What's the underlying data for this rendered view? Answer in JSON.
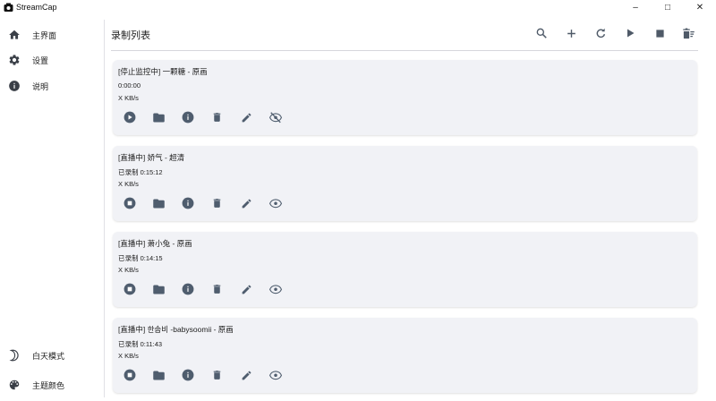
{
  "window": {
    "title": "StreamCap",
    "controls": {
      "minimize": "–",
      "maximize": "□",
      "close": "✕"
    }
  },
  "sidebar": {
    "items": [
      {
        "label": "主界面",
        "icon": "home-icon"
      },
      {
        "label": "设置",
        "icon": "gear-icon"
      },
      {
        "label": "说明",
        "icon": "info-icon"
      }
    ],
    "bottom": [
      {
        "label": "白天模式",
        "icon": "moon-icon"
      },
      {
        "label": "主题颜色",
        "icon": "palette-icon"
      }
    ]
  },
  "header": {
    "title": "录制列表",
    "tools": [
      "search-icon",
      "add-icon",
      "refresh-icon",
      "play-all-icon",
      "stop-all-icon",
      "delete-all-icon"
    ]
  },
  "recordings": [
    {
      "title": "[停止监控中] 一颗糖 - 原画",
      "line2": "0:00:00",
      "speed": "X KB/s",
      "primary_action": "play-circle-icon",
      "visibility": "eye-off-icon"
    },
    {
      "title": "[直播中] 娇气 - 超清",
      "line2": "已录制 0:15:12",
      "speed": "X KB/s",
      "primary_action": "stop-circle-icon",
      "visibility": "eye-icon"
    },
    {
      "title": "[直播中] 萧小兔 - 原画",
      "line2": "已录制 0:14:15",
      "speed": "X KB/s",
      "primary_action": "stop-circle-icon",
      "visibility": "eye-icon"
    },
    {
      "title": "[直播中] 한솜비 -babysoomii - 原画",
      "line2": "已录制 0:11:43",
      "speed": "X KB/s",
      "primary_action": "stop-circle-icon",
      "visibility": "eye-icon"
    }
  ],
  "colors": {
    "card_bg": "#f1f2f6",
    "icon": "#4f5d6e",
    "text": "#222222"
  }
}
